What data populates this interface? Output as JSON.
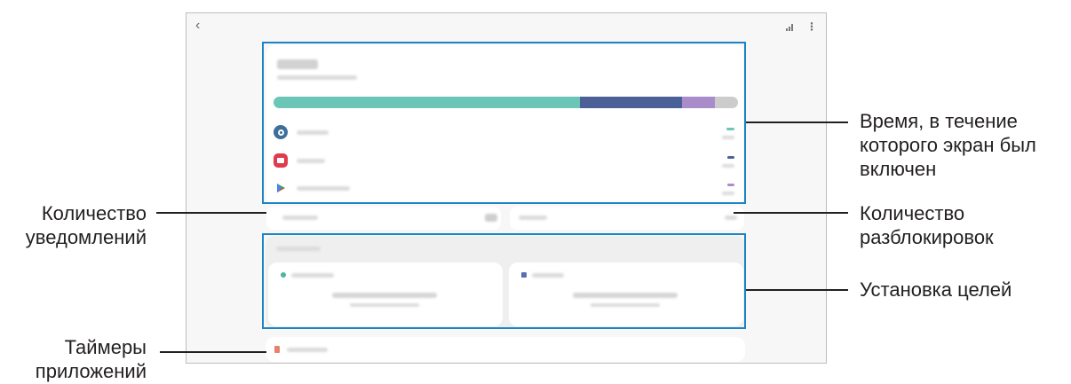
{
  "screen": {
    "back_icon": "chevron-left-icon",
    "stats_icon": "bar-chart-icon",
    "more_icon": "more-vertical-icon"
  },
  "usage": {
    "bar_segments": [
      {
        "fraction": 0.66,
        "color": "#6cc6b8"
      },
      {
        "fraction": 0.22,
        "color": "#4a6097"
      },
      {
        "fraction": 0.07,
        "color": "#a98cca"
      },
      {
        "fraction": 0.05,
        "color": "#cccccc"
      }
    ],
    "apps": [
      {
        "icon": "settings-app-icon",
        "color": "#3d6f9a",
        "bar_color": "#6cc6b8",
        "bar_fraction": 0.018
      },
      {
        "icon": "video-app-icon",
        "color": "#e03a4b",
        "bar_color": "#4a6097",
        "bar_fraction": 0.016
      },
      {
        "icon": "play-store-icon",
        "color": "#ffffff",
        "bar_color": "#a98cca",
        "bar_fraction": 0.016
      }
    ]
  },
  "annotations": {
    "screen_time": [
      "Время, в течение",
      "которого экран был",
      "включен"
    ],
    "notifications": [
      "Количество",
      "уведомлений"
    ],
    "unlocks": [
      "Количество",
      "разблокировок"
    ],
    "goals": [
      "Установка целей"
    ],
    "app_timers": [
      "Таймеры",
      "приложений"
    ]
  },
  "colors": {
    "frame": "#1c84c2",
    "callout": "#231f20"
  }
}
